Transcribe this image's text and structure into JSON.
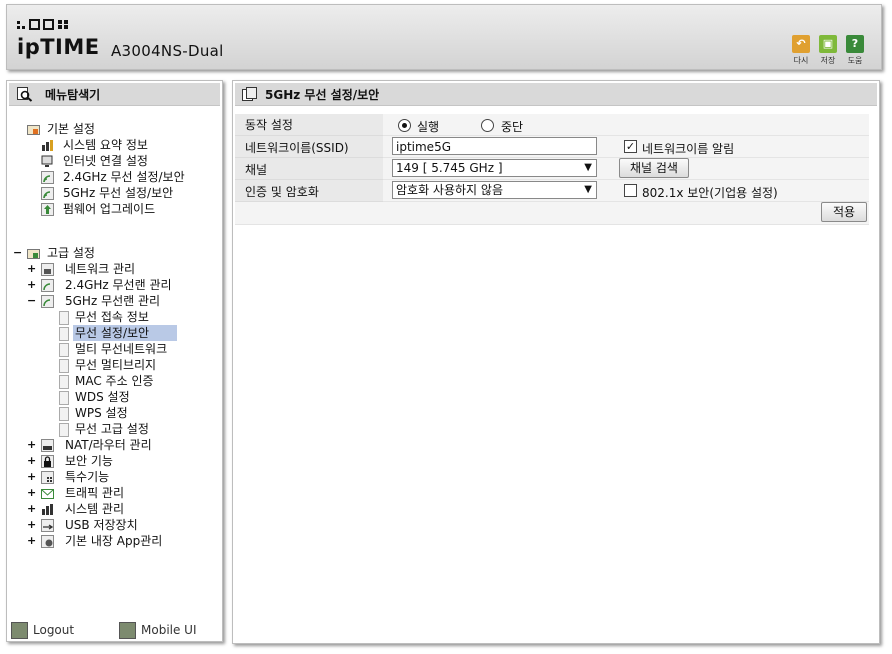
{
  "header": {
    "brand": "ipTIME",
    "model": "A3004NS-Dual",
    "buttons": [
      {
        "label": "다시",
        "icon": "undo-icon",
        "color": "#e0a030"
      },
      {
        "label": "저장",
        "icon": "save-icon",
        "color": "#7fb93a"
      },
      {
        "label": "도움",
        "icon": "help-icon",
        "color": "#3a8a3a"
      }
    ]
  },
  "left": {
    "title": "메뉴탐색기",
    "basic_group": "기본 설정",
    "basic_items": [
      "시스템 요약 정보",
      "인터넷 연결 설정",
      "2.4GHz 무선 설정/보안",
      "5GHz 무선 설정/보안",
      "펌웨어 업그레이드"
    ],
    "advanced_group": "고급 설정",
    "adv_network": "네트워크 관리",
    "adv_24": "2.4GHz 무선랜 관리",
    "adv_5": "5GHz 무선랜 관리",
    "adv_5_items": [
      "무선 접속 정보",
      "무선 설정/보안",
      "멀티 무선네트워크",
      "무선 멀티브리지",
      "MAC 주소 인증",
      "WDS 설정",
      "WPS 설정",
      "무선 고급 설정"
    ],
    "adv_rest": [
      "NAT/라우터 관리",
      "보안 기능",
      "특수기능",
      "트래픽 관리",
      "시스템 관리",
      "USB 저장장치",
      "기본 내장 App관리"
    ],
    "logout": "Logout",
    "mobile": "Mobile UI"
  },
  "right": {
    "title": "5GHz 무선 설정/보안",
    "rows": {
      "mode_label": "동작 설정",
      "mode_on": "실행",
      "mode_off": "중단",
      "ssid_label": "네트워크이름(SSID)",
      "ssid_value": "iptime5G",
      "broadcast_label": "네트워크이름 알림",
      "channel_label": "채널",
      "channel_value": "149 [ 5.745 GHz ]",
      "channel_scan": "채널 검색",
      "auth_label": "인증 및 암호화",
      "auth_value": "암호화 사용하지 않음",
      "dot1x_label": "802.1x 보안(기업용 설정)",
      "apply": "적용"
    }
  }
}
